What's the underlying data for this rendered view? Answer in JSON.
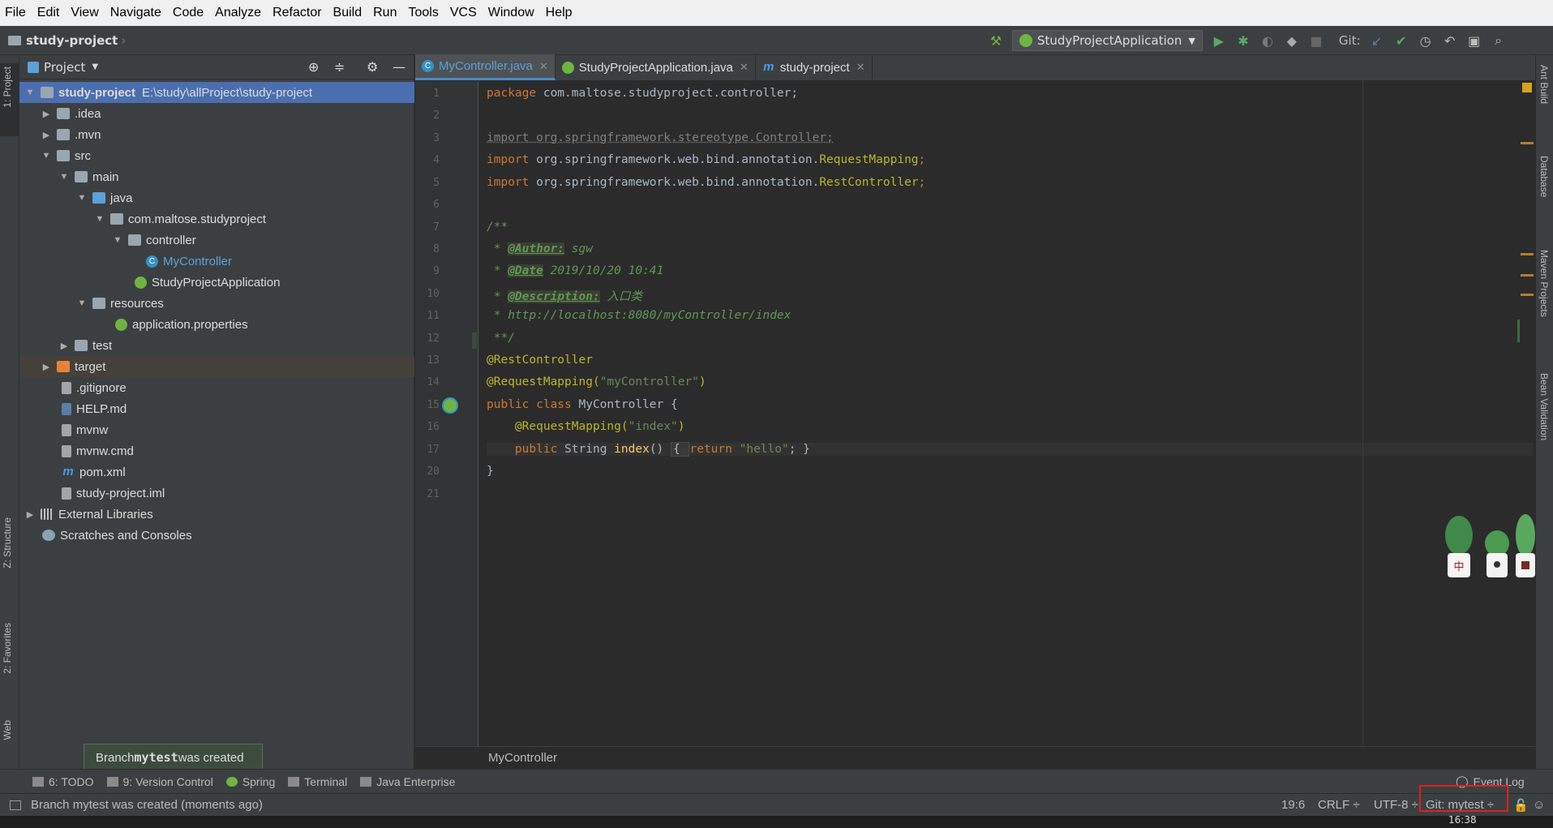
{
  "menu": [
    "File",
    "Edit",
    "View",
    "Navigate",
    "Code",
    "Analyze",
    "Refactor",
    "Build",
    "Run",
    "Tools",
    "VCS",
    "Window",
    "Help"
  ],
  "navbar": {
    "project": "study-project",
    "run_config": "StudyProjectApplication",
    "git_label": "Git:"
  },
  "left_tabs": {
    "project": "1: Project",
    "structure": "Z: Structure",
    "favorites": "2: Favorites",
    "web": "Web"
  },
  "right_tabs": {
    "ant": "Ant Build",
    "database": "Database",
    "maven": "Maven Projects",
    "bean": "Bean Validation"
  },
  "project_panel": {
    "title": "Project",
    "tree": [
      {
        "label": "study-project",
        "extra": "E:\\study\\allProject\\study-project"
      },
      {
        "label": ".idea"
      },
      {
        "label": ".mvn"
      },
      {
        "label": "src"
      },
      {
        "label": "main"
      },
      {
        "label": "java"
      },
      {
        "label": "com.maltose.studyproject"
      },
      {
        "label": "controller"
      },
      {
        "label": "MyController"
      },
      {
        "label": "StudyProjectApplication"
      },
      {
        "label": "resources"
      },
      {
        "label": "application.properties"
      },
      {
        "label": "test"
      },
      {
        "label": "target"
      },
      {
        "label": ".gitignore"
      },
      {
        "label": "HELP.md"
      },
      {
        "label": "mvnw"
      },
      {
        "label": "mvnw.cmd"
      },
      {
        "label": "pom.xml"
      },
      {
        "label": "study-project.iml"
      },
      {
        "label": "External Libraries"
      },
      {
        "label": "Scratches and Consoles"
      }
    ]
  },
  "editor_tabs": [
    {
      "label": "MyController.java"
    },
    {
      "label": "StudyProjectApplication.java"
    },
    {
      "label": "study-project"
    }
  ],
  "line_numbers": [
    "1",
    "2",
    "3",
    "4",
    "5",
    "6",
    "7",
    "8",
    "9",
    "10",
    "11",
    "12",
    "13",
    "14",
    "15",
    "16",
    "17",
    "20",
    "21"
  ],
  "code": {
    "l1a": "package",
    "l1b": " com.maltose.studyproject.controller;",
    "l3": "import org.springframework.stereotype.Controller;",
    "l4a": "import",
    "l4b": " org.springframework.web.bind.annotation.",
    "l4c": "RequestMapping",
    "l4d": ";",
    "l5a": "import",
    "l5b": " org.springframework.web.bind.annotation.",
    "l5c": "RestController",
    "l5d": ";",
    "l7": "/**",
    "l8a": " * ",
    "l8b": "@Author:",
    "l8c": " sgw",
    "l9a": " * ",
    "l9b": "@Date",
    "l9c": " 2019/10/20 10:41",
    "l10a": " * ",
    "l10b": "@Description:",
    "l10c": " 入口类",
    "l11": " * http://localhost:8080/myController/index",
    "l12": " **/",
    "l13": "@RestController",
    "l14a": "@RequestMapping(",
    "l14b": "\"myController\"",
    "l14c": ")",
    "l15a": "public class",
    "l15b": " MyController {",
    "l16a": "    @RequestMapping(",
    "l16b": "\"index\"",
    "l16c": ")",
    "l17a": "    public",
    "l17b": " String ",
    "l17c": "index",
    "l17d": "() ",
    "l17e": "{ ",
    "l17f": "return",
    "l17g": " \"hello\"",
    "l17h": "; }",
    "l20": "}"
  },
  "breadcrumb_bottom": "MyController",
  "tooltip": {
    "prefix": "Branch ",
    "branch": "mytest",
    "suffix": " was created"
  },
  "bottom_tools": [
    {
      "label": "6: TODO"
    },
    {
      "label": "9: Version Control"
    },
    {
      "label": "Spring"
    },
    {
      "label": "Terminal"
    },
    {
      "label": "Java Enterprise"
    }
  ],
  "event_log": "Event Log",
  "status": {
    "message": "Branch mytest was created (moments ago)",
    "position": "19:6",
    "line_sep": "CRLF ÷",
    "encoding": "UTF-8 ÷",
    "git": "Git: mytest ÷"
  },
  "taskbar_time": "16:38",
  "colors": {
    "accent": "#4a88c7",
    "selection": "#4b6eaf",
    "highlight_box": "#e02020",
    "editor_bg": "#2b2b2b"
  }
}
